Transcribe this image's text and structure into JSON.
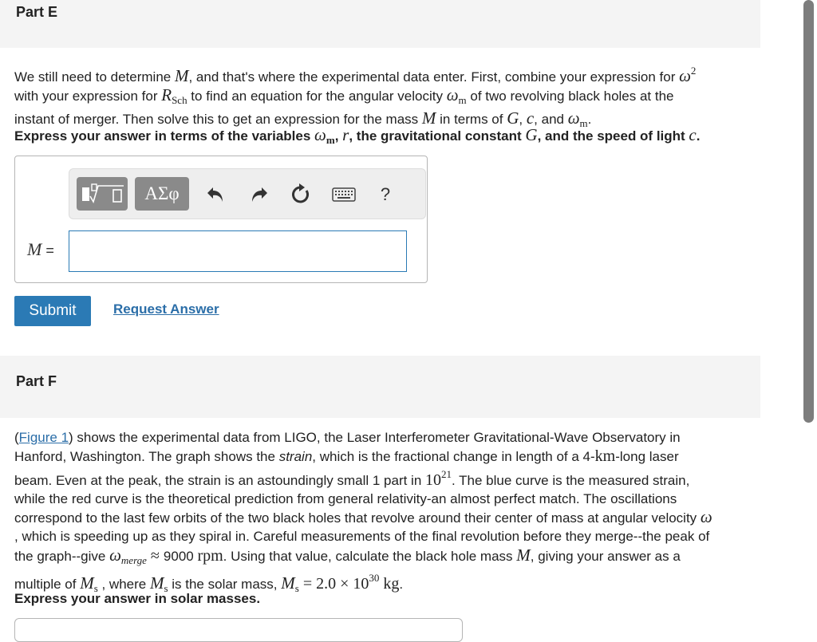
{
  "part_e": {
    "title": "Part E",
    "p1_l1a": "We still need to determine ",
    "p1_l1_M": "M",
    "p1_l1b": ", and that's where the experimental data enter. First, combine your expression for ",
    "p1_l1_omega": "ω",
    "p1_l1_sup": "2",
    "p1_l2a": "with your expression for ",
    "p1_l2_R": "R",
    "p1_l2_Rsub": "Sch",
    "p1_l2b": " to find an equation for the angular velocity ",
    "p1_l2_w": "ω",
    "p1_l2_wsub": "m",
    "p1_l2c": " of two revolving black holes at the",
    "p1_l3a": "instant of merger. Then solve this to get an expression for the mass ",
    "p1_l3_M": "M",
    "p1_l3b": " in terms of ",
    "p1_l3_G": "G",
    "p1_l3c": ", ",
    "p1_l3_c": "c",
    "p1_l3d": ", and ",
    "p1_l3_w": "ω",
    "p1_l3_wsub": "m",
    "p1_l3e": ".",
    "instr_a": "Express your answer in terms of the variables ",
    "instr_w": "ω",
    "instr_wsub": "m",
    "instr_b": ", ",
    "instr_r": "r",
    "instr_c": ", the gravitational constant ",
    "instr_G": "G",
    "instr_d": ", and the speed of light ",
    "instr_cc": "c",
    "instr_e": ".",
    "toolbar": {
      "greek_label": "ΑΣφ",
      "help_label": "?"
    },
    "answer_label_var": "M",
    "answer_label_eq": " =",
    "answer_value": "",
    "submit_label": "Submit",
    "request_label": "Request Answer"
  },
  "part_f": {
    "title": "Part F",
    "l1_open": "(",
    "l1_fig": "Figure 1",
    "l1_rest": ") shows the experimental data from LIGO, the Laser Interferometer Gravitational-Wave Observatory in",
    "l2a": "Hanford, Washington. The graph shows the ",
    "l2_strain": "strain",
    "l2b": ", which is the fractional change in length of a 4-",
    "l2_km": "km",
    "l2c": "-long laser",
    "l3a": "beam. Even at the peak, the strain is an astoundingly small 1 part in ",
    "l3_10": "10",
    "l3_sup": "21",
    "l3b": ". The blue curve is the measured strain,",
    "l4": "while the red curve is the theoretical prediction from general relativity-an almost perfect match. The oscillations",
    "l5a": "correspond to the last few orbits of the two black holes that revolve around their center of mass at angular velocity ",
    "l5_w": "ω",
    "l6": ", which is speeding up as they spiral in. Careful measurements of the final revolution before they merge--the peak of",
    "l7a": "the graph--give ",
    "l7_w": "ω",
    "l7_wsub": "merge",
    "l7_approx": " ≈ ",
    "l7_val": "9000 ",
    "l7_unit": "rpm",
    "l7b": ". Using that value, calculate the black hole mass ",
    "l7_M": "M",
    "l7c": ", giving your answer as a",
    "l8a": "multiple of ",
    "l8_Ms": "M",
    "l8_Ms_sub": "s",
    "l8b": " , where ",
    "l8_Ms2": "M",
    "l8_Ms2_sub": "s",
    "l8c": " is the solar mass, ",
    "l8_Ms3": "M",
    "l8_Ms3_sub": "s",
    "l8_eq": " = 2.0 × 10",
    "l8_sup": "30",
    "l8_kg": " kg",
    "l8d": ".",
    "instr": "Express your answer in solar masses."
  }
}
